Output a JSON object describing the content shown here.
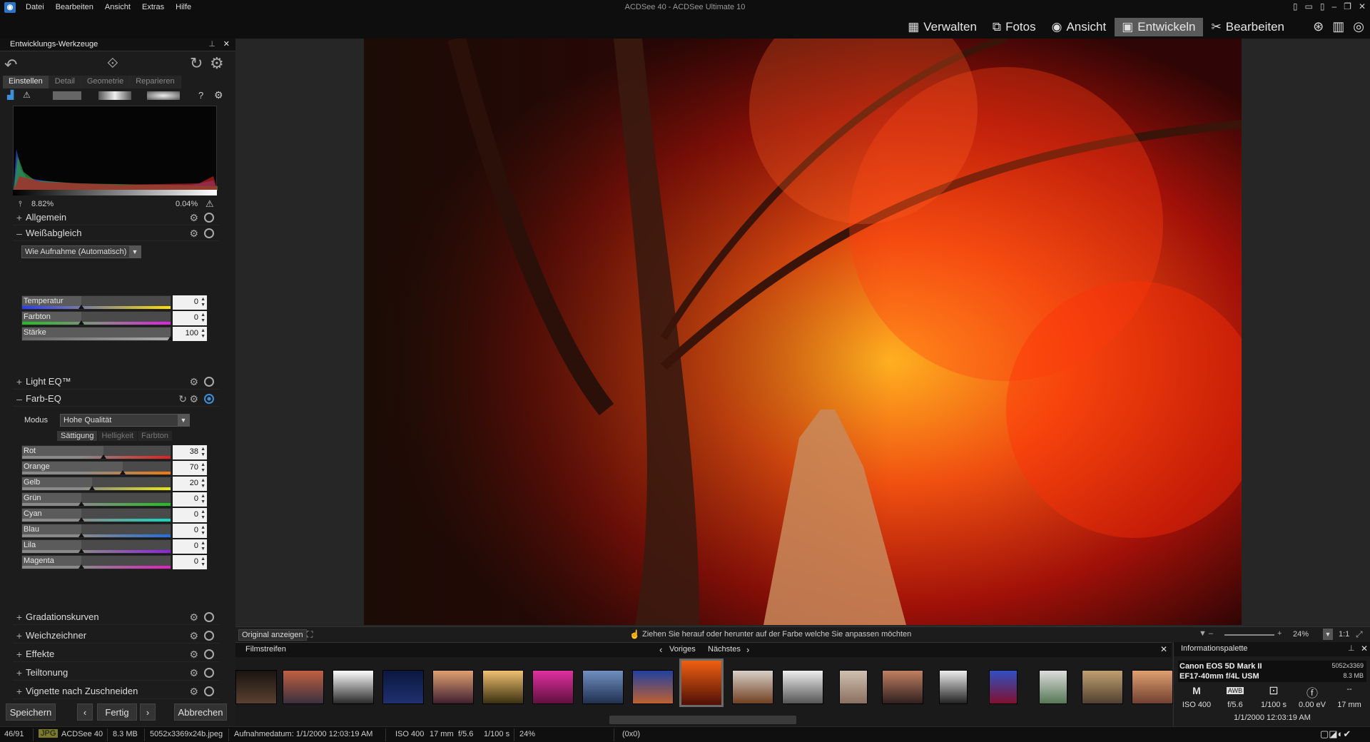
{
  "menubar": {
    "app_icon": "acdsee-app-icon",
    "items": [
      "Datei",
      "Bearbeiten",
      "Ansicht",
      "Extras",
      "Hilfe"
    ],
    "title": "ACDSee 40 - ACDSee Ultimate 10"
  },
  "modes": {
    "items": [
      {
        "label": "Verwalten",
        "icon": "grid-icon"
      },
      {
        "label": "Fotos",
        "icon": "photos-icon"
      },
      {
        "label": "Ansicht",
        "icon": "eye-icon"
      },
      {
        "label": "Entwickeln",
        "icon": "develop-icon",
        "active": true
      },
      {
        "label": "Bearbeiten",
        "icon": "edit-tools-icon"
      }
    ],
    "extra_icons": [
      "365-icon",
      "dashboard-icon",
      "eye-eq-icon"
    ]
  },
  "panel": {
    "title": "Entwicklungs-Werkzeuge",
    "tabs": [
      "Einstellen",
      "Detail",
      "Geometrie",
      "Reparieren"
    ],
    "hist_left": "8.82%",
    "hist_right": "0.04%",
    "sections": {
      "allgemein": "Allgemein",
      "weissabgleich": "Weißabgleich",
      "lighteq": "Light EQ™",
      "farbeq": "Farb-EQ",
      "gradation": "Gradationskurven",
      "weichzeichner": "Weichzeichner",
      "effekte": "Effekte",
      "teiltonung": "Teiltonung",
      "vignette": "Vignette nach Zuschneiden"
    },
    "wb": {
      "preset": "Wie Aufnahme (Automatisch)",
      "sliders": [
        {
          "label": "Temperatur",
          "value": "0",
          "pos": 0.4
        },
        {
          "label": "Farbton",
          "value": "0",
          "pos": 0.4
        },
        {
          "label": "Stärke",
          "value": "100",
          "pos": 1.0
        }
      ]
    },
    "ceq": {
      "modus_label": "Modus",
      "modus": "Hohe Qualität",
      "subtabs": [
        "Sättigung",
        "Helligkeit",
        "Farbton"
      ],
      "sliders": [
        {
          "label": "Rot",
          "value": "38",
          "pos": 0.55
        },
        {
          "label": "Orange",
          "value": "70",
          "pos": 0.68
        },
        {
          "label": "Gelb",
          "value": "20",
          "pos": 0.47
        },
        {
          "label": "Grün",
          "value": "0",
          "pos": 0.4
        },
        {
          "label": "Cyan",
          "value": "0",
          "pos": 0.4
        },
        {
          "label": "Blau",
          "value": "0",
          "pos": 0.4
        },
        {
          "label": "Lila",
          "value": "0",
          "pos": 0.4
        },
        {
          "label": "Magenta",
          "value": "0",
          "pos": 0.4
        }
      ]
    },
    "buttons": {
      "save": "Speichern",
      "done": "Fertig",
      "cancel": "Abbrechen"
    }
  },
  "viewer": {
    "original": "Original anzeigen",
    "hint": "Ziehen Sie herauf oder herunter auf der Farbe welche Sie anpassen möchten",
    "zoom": "24%",
    "one_to_one": "1:1"
  },
  "film": {
    "title": "Filmstreifen",
    "prev": "Voriges",
    "next": "Nächstes"
  },
  "info": {
    "title": "Informationspalette",
    "camera": "Canon EOS 5D Mark II",
    "lens": "EF17-40mm f/4L USM",
    "dims": "5052x3369",
    "size": "8.3 MB",
    "mode": "M",
    "wb": "AWB",
    "iso": "ISO 400",
    "fstop": "f/5.6",
    "shutter": "1/100 s",
    "ev": "0.00 eV",
    "focal": "17 mm",
    "flash": "--",
    "date": "1/1/2000 12:03:19 AM"
  },
  "status": {
    "count": "46/91",
    "format": "JPG",
    "app": "ACDSee 40",
    "size": "8.3 MB",
    "file": "5052x3369x24b.jpeg",
    "date": "Aufnahmedatum: 1/1/2000 12:03:19 AM",
    "iso": "ISO 400",
    "focal": "17 mm",
    "fstop": "f/5.6",
    "shutter": "1/100 s",
    "zoom": "24%",
    "coords": "(0x0)"
  }
}
